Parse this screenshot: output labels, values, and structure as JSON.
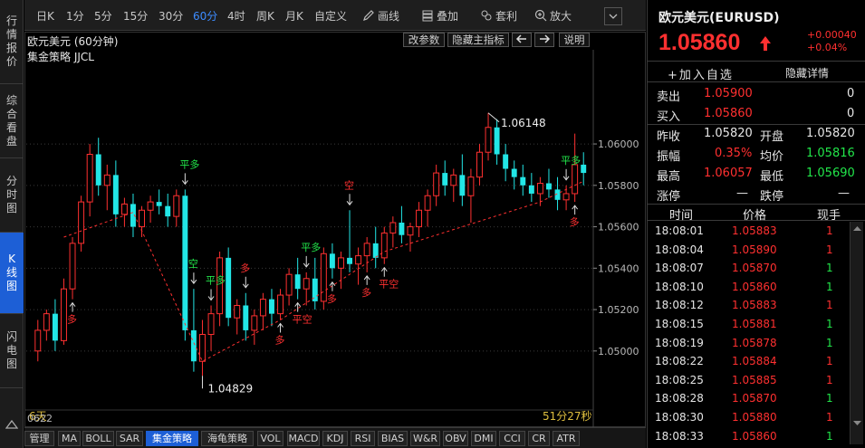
{
  "left_tabs": [
    {
      "label": "行情报价",
      "chars": [
        "行",
        "情",
        "报",
        "价"
      ],
      "active": false
    },
    {
      "label": "综合看盘",
      "chars": [
        "综",
        "合",
        "看",
        "盘"
      ],
      "active": false
    },
    {
      "label": "分时图",
      "chars": [
        "分",
        "时",
        "图"
      ],
      "active": false
    },
    {
      "label": "K线图",
      "chars": [
        "K",
        "线",
        "图"
      ],
      "active": true
    },
    {
      "label": "闪电图",
      "chars": [
        "闪",
        "电",
        "图"
      ],
      "active": false
    }
  ],
  "periods": [
    {
      "label": "日K",
      "active": false
    },
    {
      "label": "1分",
      "active": false
    },
    {
      "label": "5分",
      "active": false
    },
    {
      "label": "15分",
      "active": false
    },
    {
      "label": "30分",
      "active": false
    },
    {
      "label": "60分",
      "active": true
    },
    {
      "label": "4时",
      "active": false
    },
    {
      "label": "周K",
      "active": false
    },
    {
      "label": "月K",
      "active": false
    },
    {
      "label": "自定义",
      "active": false
    }
  ],
  "tools": [
    {
      "label": "画线",
      "icon": "pencil-icon"
    },
    {
      "label": "叠加",
      "icon": "stack-icon"
    },
    {
      "label": "套利",
      "icon": "arbitrage-icon"
    },
    {
      "label": "放大",
      "icon": "zoom-in-icon"
    }
  ],
  "chart_header": {
    "title": "欧元美元 (60分钟)",
    "change_params": "改参数",
    "hide_indicator": "隐藏主指标",
    "help": "说明"
  },
  "strategy_label": "集金策略 JJCL",
  "chart_data": {
    "type": "candlestick",
    "y_ticks": [
      1.06,
      1.058,
      1.056,
      1.054,
      1.052,
      1.05
    ],
    "ylim": [
      1.0475,
      1.0635
    ],
    "annotations": {
      "high_label": "1.06148",
      "low_label": "1.04829",
      "days": "6天",
      "countdown": "51分27秒",
      "period_start": "0622"
    },
    "signals": [
      "多",
      "平多",
      "空",
      "平多",
      "多",
      "多",
      "平空",
      "平多",
      "多",
      "空",
      "多",
      "平空",
      "平多",
      "多"
    ],
    "candles": [
      [
        1.05,
        1.0515,
        1.0495,
        1.051
      ],
      [
        1.051,
        1.052,
        1.0505,
        1.0518
      ],
      [
        1.0518,
        1.0525,
        1.05,
        1.0505
      ],
      [
        1.0505,
        1.0535,
        1.0503,
        1.053
      ],
      [
        1.053,
        1.0555,
        1.0525,
        1.0552
      ],
      [
        1.0552,
        1.0575,
        1.0548,
        1.0572
      ],
      [
        1.0572,
        1.06,
        1.0565,
        1.0595
      ],
      [
        1.0595,
        1.0603,
        1.0575,
        1.058
      ],
      [
        1.058,
        1.059,
        1.0568,
        1.0585
      ],
      [
        1.0585,
        1.0592,
        1.056,
        1.0566
      ],
      [
        1.0566,
        1.0574,
        1.056,
        1.0571
      ],
      [
        1.0571,
        1.0576,
        1.0555,
        1.056
      ],
      [
        1.056,
        1.057,
        1.0555,
        1.0568
      ],
      [
        1.0568,
        1.0575,
        1.0562,
        1.0572
      ],
      [
        1.0572,
        1.0578,
        1.0566,
        1.057
      ],
      [
        1.057,
        1.0576,
        1.056,
        1.0565
      ],
      [
        1.0565,
        1.0578,
        1.056,
        1.0575
      ],
      [
        1.0575,
        1.0578,
        1.0505,
        1.051
      ],
      [
        1.051,
        1.053,
        1.049,
        1.0495
      ],
      [
        1.0495,
        1.0515,
        1.0488,
        1.0508
      ],
      [
        1.0508,
        1.0522,
        1.05,
        1.0518
      ],
      [
        1.0518,
        1.0548,
        1.0512,
        1.0545
      ],
      [
        1.0545,
        1.055,
        1.0512,
        1.0516
      ],
      [
        1.0516,
        1.0525,
        1.0508,
        1.0522
      ],
      [
        1.0522,
        1.0528,
        1.0505,
        1.051
      ],
      [
        1.051,
        1.052,
        1.0503,
        1.0517
      ],
      [
        1.0517,
        1.0528,
        1.051,
        1.0525
      ],
      [
        1.0525,
        1.053,
        1.0512,
        1.0518
      ],
      [
        1.0518,
        1.053,
        1.0515,
        1.0527
      ],
      [
        1.0527,
        1.054,
        1.0522,
        1.0537
      ],
      [
        1.0537,
        1.0545,
        1.0525,
        1.053
      ],
      [
        1.053,
        1.0538,
        1.0522,
        1.0535
      ],
      [
        1.0535,
        1.0545,
        1.052,
        1.0524
      ],
      [
        1.0524,
        1.055,
        1.052,
        1.0547
      ],
      [
        1.0547,
        1.0552,
        1.0535,
        1.054
      ],
      [
        1.054,
        1.0548,
        1.053,
        1.0545
      ],
      [
        1.0545,
        1.0568,
        1.0538,
        1.0542
      ],
      [
        1.0542,
        1.055,
        1.0532,
        1.0546
      ],
      [
        1.0546,
        1.0555,
        1.0538,
        1.0552
      ],
      [
        1.0552,
        1.056,
        1.054,
        1.0545
      ],
      [
        1.0545,
        1.056,
        1.0542,
        1.0557
      ],
      [
        1.0557,
        1.0565,
        1.055,
        1.0562
      ],
      [
        1.0562,
        1.057,
        1.0552,
        1.0556
      ],
      [
        1.0556,
        1.0562,
        1.0548,
        1.056
      ],
      [
        1.056,
        1.0572,
        1.0555,
        1.0568
      ],
      [
        1.0568,
        1.0578,
        1.056,
        1.0575
      ],
      [
        1.0575,
        1.059,
        1.057,
        1.0586
      ],
      [
        1.0586,
        1.0592,
        1.0575,
        1.058
      ],
      [
        1.058,
        1.0588,
        1.0572,
        1.0585
      ],
      [
        1.0585,
        1.0595,
        1.057,
        1.0575
      ],
      [
        1.0575,
        1.0588,
        1.0562,
        1.0584
      ],
      [
        1.0584,
        1.06,
        1.058,
        1.0596
      ],
      [
        1.0596,
        1.0615,
        1.0592,
        1.0608
      ],
      [
        1.0608,
        1.0612,
        1.059,
        1.0595
      ],
      [
        1.0595,
        1.06,
        1.0582,
        1.0588
      ],
      [
        1.0588,
        1.0592,
        1.0578,
        1.0584
      ],
      [
        1.0584,
        1.059,
        1.0575,
        1.058
      ],
      [
        1.058,
        1.0586,
        1.0572,
        1.0576
      ],
      [
        1.0576,
        1.0584,
        1.057,
        1.0581
      ],
      [
        1.0581,
        1.0588,
        1.0574,
        1.0578
      ],
      [
        1.0578,
        1.0584,
        1.0568,
        1.0573
      ],
      [
        1.0573,
        1.058,
        1.0568,
        1.0576
      ],
      [
        1.0576,
        1.0605,
        1.0572,
        1.059
      ],
      [
        1.059,
        1.0596,
        1.058,
        1.0586
      ]
    ]
  },
  "bottom_tabs": [
    {
      "label": "管理",
      "active": false
    },
    {
      "label": "MA",
      "active": false
    },
    {
      "label": "BOLL",
      "active": false
    },
    {
      "label": "SAR",
      "active": false
    },
    {
      "label": "集金策略",
      "active": true
    },
    {
      "label": "海龟策略",
      "active": false
    },
    {
      "label": "VOL",
      "active": false
    },
    {
      "label": "MACD",
      "active": false
    },
    {
      "label": "KDJ",
      "active": false
    },
    {
      "label": "RSI",
      "active": false
    },
    {
      "label": "BIAS",
      "active": false
    },
    {
      "label": "W&R",
      "active": false
    },
    {
      "label": "OBV",
      "active": false
    },
    {
      "label": "DMI",
      "active": false
    },
    {
      "label": "CCI",
      "active": false
    },
    {
      "label": "CR",
      "active": false
    },
    {
      "label": "ATR",
      "active": false
    }
  ],
  "quote": {
    "title": "欧元美元(EURUSD)",
    "price": "1.05860",
    "change_abs": "+0.00040",
    "change_pct": "+0.04%",
    "add_watch": "+加入自选",
    "hide_detail": "隐藏详情",
    "sell_label": "卖出",
    "sell_price": "1.05900",
    "sell_vol": "0",
    "buy_label": "买入",
    "buy_price": "1.05860",
    "buy_vol": "0",
    "prev_close_label": "昨收",
    "prev_close": "1.05820",
    "open_label": "开盘",
    "open": "1.05820",
    "amp_label": "振幅",
    "amp": "0.35%",
    "avg_label": "均价",
    "avg": "1.05816",
    "high_label": "最高",
    "high": "1.06057",
    "low_label": "最低",
    "low": "1.05690",
    "limit_up_label": "涨停",
    "limit_up": "—",
    "limit_down_label": "跌停",
    "limit_down": "—"
  },
  "trades": {
    "headers": [
      "时间",
      "价格",
      "现手"
    ],
    "rows": [
      {
        "time": "18:08:01",
        "price": "1.05883",
        "vol": "1",
        "dir": "up"
      },
      {
        "time": "18:08:04",
        "price": "1.05890",
        "vol": "1",
        "dir": "up"
      },
      {
        "time": "18:08:07",
        "price": "1.05870",
        "vol": "1",
        "dir": "down"
      },
      {
        "time": "18:08:10",
        "price": "1.05860",
        "vol": "1",
        "dir": "down"
      },
      {
        "time": "18:08:12",
        "price": "1.05883",
        "vol": "1",
        "dir": "up"
      },
      {
        "time": "18:08:15",
        "price": "1.05881",
        "vol": "1",
        "dir": "down"
      },
      {
        "time": "18:08:19",
        "price": "1.05878",
        "vol": "1",
        "dir": "down"
      },
      {
        "time": "18:08:22",
        "price": "1.05884",
        "vol": "1",
        "dir": "up"
      },
      {
        "time": "18:08:25",
        "price": "1.05885",
        "vol": "1",
        "dir": "up"
      },
      {
        "time": "18:08:28",
        "price": "1.05870",
        "vol": "1",
        "dir": "down"
      },
      {
        "time": "18:08:30",
        "price": "1.05880",
        "vol": "1",
        "dir": "up"
      },
      {
        "time": "18:08:33",
        "price": "1.05860",
        "vol": "1",
        "dir": "down"
      }
    ]
  },
  "colors": {
    "up": "#ff3030",
    "down": "#22e6e6",
    "buy_signal": "#ff3030",
    "sell_signal": "#22e64a",
    "active": "#1d5fd6"
  }
}
